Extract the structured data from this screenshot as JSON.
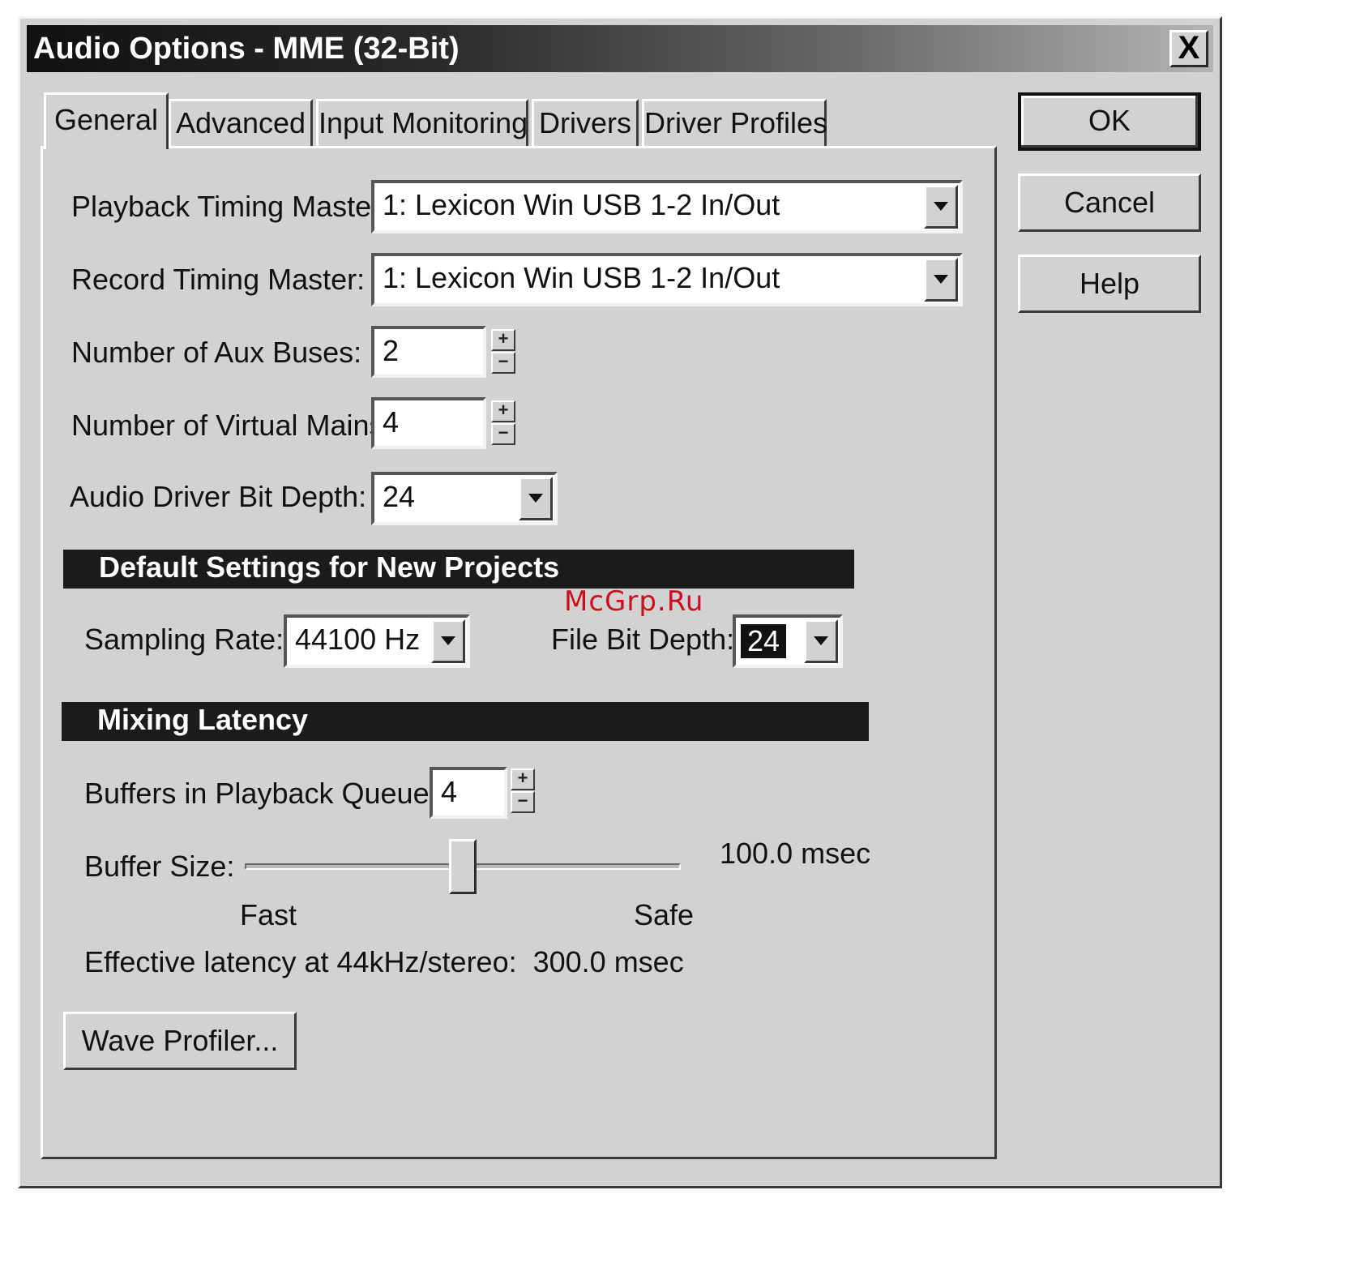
{
  "window": {
    "title": "Audio Options - MME (32-Bit)",
    "close_glyph": "X"
  },
  "tabs": [
    {
      "label": "General",
      "active": true
    },
    {
      "label": "Advanced",
      "active": false
    },
    {
      "label": "Input Monitoring",
      "active": false
    },
    {
      "label": "Drivers",
      "active": false
    },
    {
      "label": "Driver Profiles",
      "active": false
    }
  ],
  "buttons": {
    "ok": "OK",
    "cancel": "Cancel",
    "help": "Help",
    "wave_profiler": "Wave Profiler..."
  },
  "general": {
    "playback_timing_master": {
      "label": "Playback Timing Master:",
      "value": "1: Lexicon Win USB 1-2 In/Out"
    },
    "record_timing_master": {
      "label": "Record Timing Master:",
      "value": "1: Lexicon Win USB 1-2 In/Out"
    },
    "aux_buses": {
      "label": "Number of Aux Buses:",
      "value": "2"
    },
    "virtual_mains": {
      "label": "Number of Virtual Mains:",
      "value": "4"
    },
    "driver_bit_depth": {
      "label": "Audio Driver Bit Depth:",
      "value": "24"
    }
  },
  "defaults_section": {
    "title": "Default Settings for New Projects",
    "sampling_rate": {
      "label": "Sampling Rate:",
      "value": "44100 Hz"
    },
    "file_bit_depth": {
      "label": "File Bit Depth:",
      "value": "24"
    }
  },
  "latency_section": {
    "title": "Mixing Latency",
    "buffers": {
      "label": "Buffers in Playback Queue:",
      "value": "4"
    },
    "buffer_size": {
      "label": "Buffer Size:",
      "value_text": "100.0 msec",
      "slider_fraction": 0.5,
      "min_label": "Fast",
      "max_label": "Safe"
    },
    "effective_latency": "Effective latency at 44kHz/stereo:  300.0 msec"
  },
  "spin_glyphs": {
    "up": "+",
    "down": "−"
  },
  "watermark": "McGrp.Ru",
  "colors": {
    "titlebar_dark": "#111111",
    "face": "#d2d2d2",
    "section_bar": "#1b1b1b",
    "watermark": "#c8101e"
  }
}
